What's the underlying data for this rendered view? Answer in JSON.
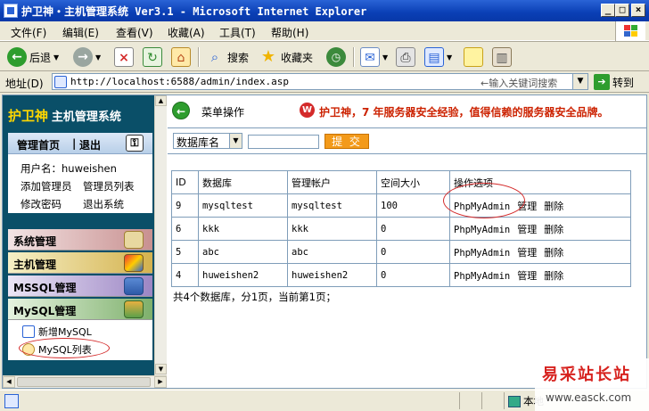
{
  "window": {
    "title": "护卫神・主机管理系统 Ver3.1 - Microsoft Internet Explorer",
    "controls": [
      "_",
      "□",
      "×"
    ]
  },
  "menubar": [
    "文件(F)",
    "编辑(E)",
    "查看(V)",
    "收藏(A)",
    "工具(T)",
    "帮助(H)"
  ],
  "toolbar": {
    "back": "后退",
    "search": "搜索",
    "favorites": "收藏夹"
  },
  "address": {
    "label": "地址(D)",
    "url": "http://localhost:6588/admin/index.asp",
    "hint": "←输入关键词搜索",
    "go": "转到"
  },
  "sidebar": {
    "brand_main": "护卫神",
    "brand_sub": "主机管理系统",
    "header_home": "管理首页",
    "header_sep": "|",
    "header_logout": "退出",
    "username_label": "用户名：",
    "username": "huweishen",
    "links": [
      "添加管理员",
      "管理员列表",
      "修改密码",
      "退出系统"
    ],
    "categories": [
      "系统管理",
      "主机管理",
      "MSSQL管理",
      "MySQL管理"
    ],
    "submenu": [
      "新增MySQL",
      "MySQL列表"
    ]
  },
  "main": {
    "op_label": "菜单操作",
    "slogan": "护卫神，7 年服务器安全经验，值得信赖的服务器安全品牌。",
    "search": {
      "select_value": "数据库名",
      "input_value": "",
      "submit": "提 交"
    },
    "table": {
      "headers": [
        "ID",
        "数据库",
        "管理帐户",
        "空间大小",
        "操作选项"
      ],
      "rows": [
        {
          "id": "9",
          "db": "mysqltest",
          "account": "mysqltest",
          "size": "100"
        },
        {
          "id": "6",
          "db": "kkk",
          "account": "kkk",
          "size": "0"
        },
        {
          "id": "5",
          "db": "abc",
          "account": "abc",
          "size": "0"
        },
        {
          "id": "4",
          "db": "huweishen2",
          "account": "huweishen2",
          "size": "0"
        }
      ],
      "actions": [
        "PhpMyAdmin",
        "管理",
        "删除"
      ]
    },
    "summary": "共4个数据库，分1页，当前第1页；"
  },
  "status": {
    "zone": "本地"
  },
  "watermark": {
    "line1": "易采站长站",
    "line2": "www.easck.com"
  }
}
